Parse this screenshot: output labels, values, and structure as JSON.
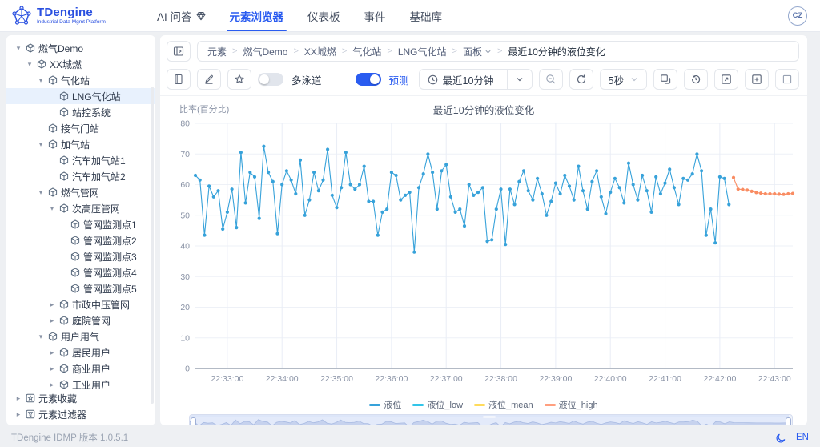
{
  "header": {
    "logo_title": "TDengine",
    "logo_subtitle": "Industrial Data Mgmt Platform",
    "nav_items": [
      {
        "label": "AI 问答",
        "icon": "gem-icon",
        "active": false
      },
      {
        "label": "元素浏览器",
        "active": true
      },
      {
        "label": "仪表板",
        "active": false
      },
      {
        "label": "事件",
        "active": false
      },
      {
        "label": "基础库",
        "active": false
      }
    ],
    "avatar_initials": "CZ"
  },
  "sidebar": {
    "tree": [
      {
        "label": "燃气Demo",
        "level": 0,
        "caret": "open"
      },
      {
        "label": "XX城燃",
        "level": 1,
        "caret": "open"
      },
      {
        "label": "气化站",
        "level": 2,
        "caret": "open"
      },
      {
        "label": "LNG气化站",
        "level": 3,
        "caret": "none",
        "selected": true
      },
      {
        "label": "站控系统",
        "level": 3,
        "caret": "none"
      },
      {
        "label": "接气门站",
        "level": 2,
        "caret": "none"
      },
      {
        "label": "加气站",
        "level": 2,
        "caret": "open"
      },
      {
        "label": "汽车加气站1",
        "level": 3,
        "caret": "none"
      },
      {
        "label": "汽车加气站2",
        "level": 3,
        "caret": "none"
      },
      {
        "label": "燃气管网",
        "level": 2,
        "caret": "open"
      },
      {
        "label": "次高压管网",
        "level": 3,
        "caret": "open"
      },
      {
        "label": "管网监测点1",
        "level": 4,
        "caret": "none"
      },
      {
        "label": "管网监测点2",
        "level": 4,
        "caret": "none"
      },
      {
        "label": "管网监测点3",
        "level": 4,
        "caret": "none"
      },
      {
        "label": "管网监测点4",
        "level": 4,
        "caret": "none"
      },
      {
        "label": "管网监测点5",
        "level": 4,
        "caret": "none"
      },
      {
        "label": "市政中压管网",
        "level": 3,
        "caret": "closed"
      },
      {
        "label": "庭院管网",
        "level": 3,
        "caret": "closed"
      },
      {
        "label": "用户用气",
        "level": 2,
        "caret": "open"
      },
      {
        "label": "居民用户",
        "level": 3,
        "caret": "closed"
      },
      {
        "label": "商业用户",
        "level": 3,
        "caret": "closed"
      },
      {
        "label": "工业用户",
        "level": 3,
        "caret": "closed"
      }
    ],
    "bottom_items": [
      {
        "label": "元素收藏",
        "icon": "star-box-icon",
        "caret": "closed"
      },
      {
        "label": "元素过滤器",
        "icon": "filter-box-icon",
        "caret": "closed"
      }
    ]
  },
  "breadcrumb": {
    "items": [
      "元素",
      "燃气Demo",
      "XX城燃",
      "气化站",
      "LNG气化站",
      "面板",
      "最近10分钟的液位变化"
    ],
    "dropdown_item": "面板"
  },
  "toolbar": {
    "swimlane_label": "多泳道",
    "swimlane_on": false,
    "forecast_label": "预测",
    "forecast_on": true,
    "time_range_value": "最近10分钟",
    "interval_value": "5秒",
    "left_icons": [
      "journal-icon",
      "edit-icon",
      "star-icon"
    ],
    "right_icons": [
      "zoom-out-icon",
      "refresh-icon",
      "export-image-icon",
      "history-icon",
      "expand-icon",
      "add-panel-icon",
      "fullscreen-icon"
    ]
  },
  "chart_data": {
    "type": "line",
    "title": "最近10分钟的液位变化",
    "ylabel": "比率(百分比)",
    "ylim": [
      0,
      80
    ],
    "y_tick_step": 10,
    "grid": true,
    "legend_position": "bottom",
    "x_ticks": [
      "22:33:00",
      "22:34:00",
      "22:35:00",
      "22:36:00",
      "22:37:00",
      "22:38:00",
      "22:39:00",
      "22:40:00",
      "22:41:00",
      "22:42:00",
      "22:43:00"
    ],
    "x_step_seconds": 5,
    "x_first_tick_offset_seconds": 35,
    "legend": [
      {
        "name": "液位",
        "color": "#37A2DA"
      },
      {
        "name": "液位_low",
        "color": "#32C5E9"
      },
      {
        "name": "液位_mean",
        "color": "#FFDB5C"
      },
      {
        "name": "液位_high",
        "color": "#FF9F7F"
      }
    ],
    "series": [
      {
        "name": "液位",
        "color": "#37A2DA",
        "values": [
          63,
          61.5,
          43.5,
          59.5,
          56,
          58,
          45.5,
          51,
          58.5,
          46,
          70.5,
          54,
          64,
          62.5,
          49,
          72.5,
          64,
          61,
          44,
          60,
          64.5,
          61.5,
          57,
          68,
          50,
          55,
          64,
          58,
          61.5,
          71.5,
          56.5,
          52.5,
          59,
          70.5,
          60,
          58.5,
          60,
          66,
          54.5,
          54.5,
          43.5,
          51,
          52,
          64,
          63,
          55,
          56.5,
          57.5,
          38,
          59,
          63.5,
          70,
          64,
          52,
          64.5,
          66.5,
          56,
          51,
          52,
          46.5,
          60,
          56.5,
          57.5,
          59,
          41.5,
          42,
          52,
          58.5,
          40.5,
          58.5,
          53.5,
          61,
          64.5,
          58,
          55,
          62,
          57,
          50,
          54.5,
          60.5,
          57,
          63,
          59.5,
          55,
          66,
          58,
          52,
          61,
          64.5,
          56,
          50.5,
          57.5,
          62,
          59,
          54,
          67,
          60,
          55,
          63,
          58,
          51,
          62.5,
          57,
          60.5,
          65,
          59,
          53.5,
          62,
          61.5,
          63.5,
          70,
          64.5,
          43.5,
          52,
          41,
          62.5,
          62,
          53.5
        ]
      }
    ],
    "forecast": {
      "name": "液位_high",
      "color": "#F98C62",
      "values": [
        62.3,
        58.5,
        58.4,
        58.2,
        57.8,
        57.4,
        57.2,
        57,
        57,
        57,
        56.9,
        56.8,
        57,
        57.1
      ]
    }
  },
  "footer": {
    "version_text": "TDengine IDMP 版本 1.0.5.1",
    "language": "EN",
    "theme_icon": "moon-icon"
  },
  "colors": {
    "accent": "#2A5CF0",
    "selected_row_bg": "#E8F1FD",
    "border": "#E4E7EC",
    "page_bg": "#EEF0F3"
  }
}
